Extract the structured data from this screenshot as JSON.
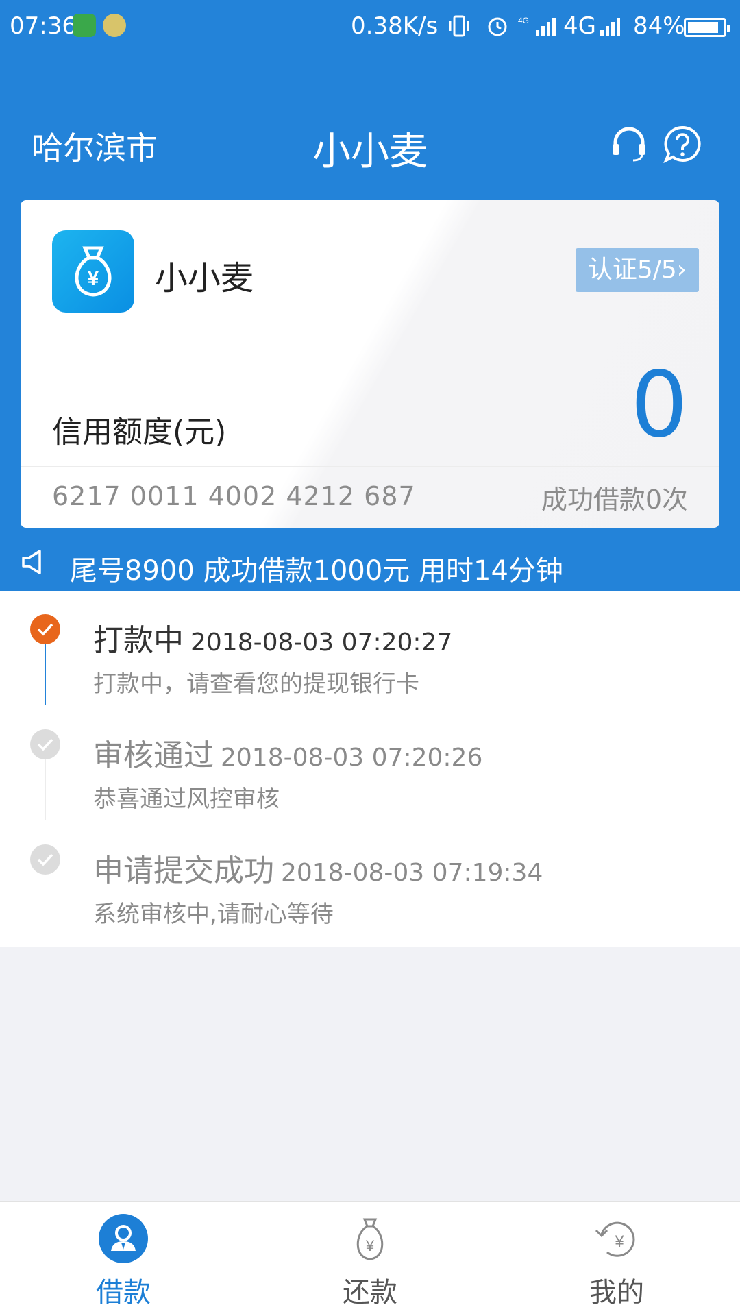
{
  "status_bar": {
    "time": "07:36",
    "network_speed": "0.38K/s",
    "network_type": "4G",
    "battery": "84%"
  },
  "header": {
    "city": "哈尔滨市",
    "title": "小小麦",
    "icons": [
      "headset-icon",
      "help-icon"
    ]
  },
  "card": {
    "app_name": "小小麦",
    "cert_label": "认证5/5",
    "credit_label": "信用额度(元)",
    "credit_value": "0",
    "card_number": "6217 0011 4002 4212 687",
    "borrow_count": "成功借款0次"
  },
  "ticker": {
    "text": "尾号8900 成功借款1000元 用时14分钟"
  },
  "timeline": [
    {
      "title": "打款中",
      "time": "2018-08-03 07:20:27",
      "desc": "打款中，请查看您的提现银行卡",
      "active": true
    },
    {
      "title": "审核通过",
      "time": "2018-08-03 07:20:26",
      "desc": "恭喜通过风控审核",
      "active": false
    },
    {
      "title": "申请提交成功",
      "time": "2018-08-03 07:19:34",
      "desc": "系统审核中,请耐心等待",
      "active": false
    }
  ],
  "nav": [
    {
      "label": "借款",
      "icon": "user-badge-icon",
      "active": true
    },
    {
      "label": "还款",
      "icon": "money-bag-icon",
      "active": false
    },
    {
      "label": "我的",
      "icon": "refresh-yuan-icon",
      "active": false
    }
  ],
  "colors": {
    "primary": "#2383d9",
    "active_step": "#e8661c",
    "inactive_step": "#dcdcdc",
    "nav_active": "#1d7fd6"
  }
}
